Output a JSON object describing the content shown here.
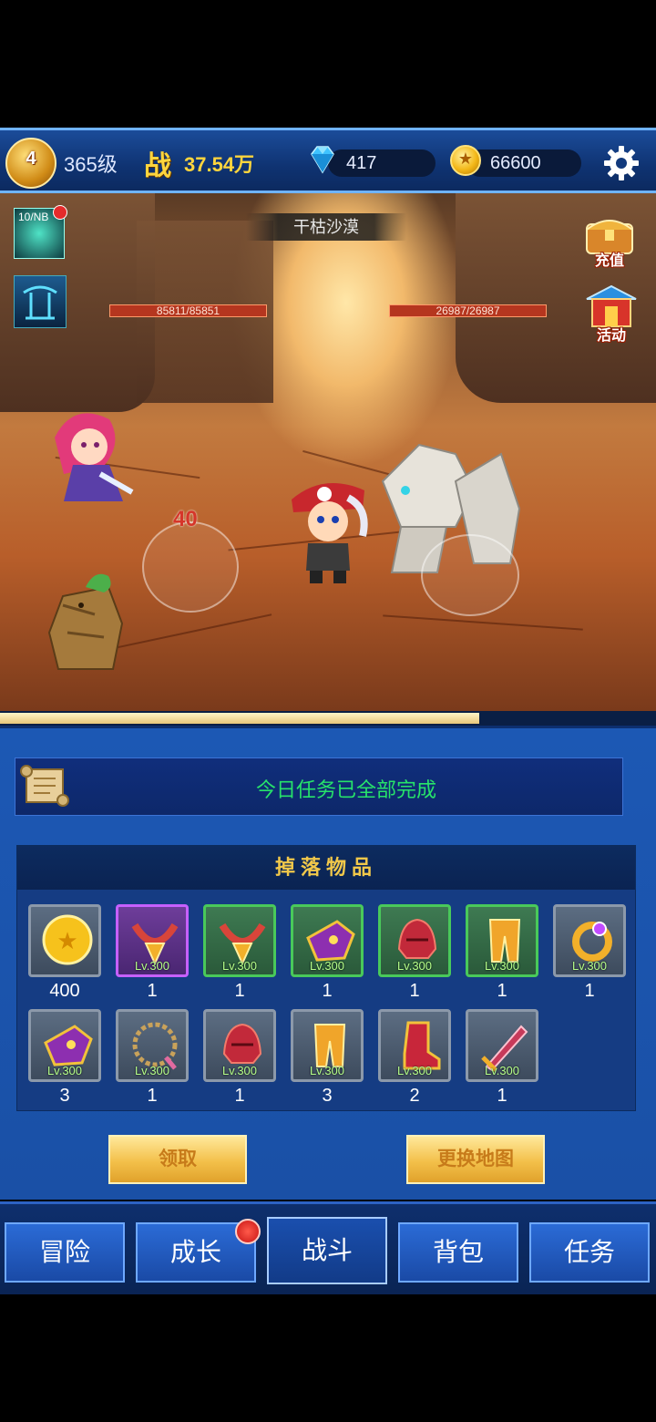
{
  "top_bar": {
    "player_level_badge": "4",
    "player_level": "365级",
    "power_label": "战",
    "power_value": "37.54万",
    "gems": "417",
    "gold": "66600"
  },
  "battle": {
    "location": "干枯沙漠",
    "ally_hp": "85811/85851",
    "enemy_hp": "26987/26987",
    "skill_count": "10/NB",
    "damage_popup": "40",
    "side_buttons": {
      "recharge": "充值",
      "event": "活动"
    }
  },
  "stage_progress": 0.73,
  "task": {
    "text": "今日任务已全部完成"
  },
  "drops": {
    "title": "掉落物品",
    "items": [
      {
        "kind": "gold-coin",
        "rarity": "gray",
        "level": "",
        "qty": "400"
      },
      {
        "kind": "necklace",
        "rarity": "purple",
        "level": "Lv.300",
        "qty": "1"
      },
      {
        "kind": "necklace",
        "rarity": "green",
        "level": "Lv.300",
        "qty": "1"
      },
      {
        "kind": "gauntlet",
        "rarity": "green",
        "level": "Lv.300",
        "qty": "1"
      },
      {
        "kind": "helmet",
        "rarity": "green",
        "level": "Lv.300",
        "qty": "1"
      },
      {
        "kind": "leg-armor",
        "rarity": "green",
        "level": "Lv.300",
        "qty": "1"
      },
      {
        "kind": "ring",
        "rarity": "gray",
        "level": "Lv.300",
        "qty": "1"
      },
      {
        "kind": "gauntlet",
        "rarity": "gray",
        "level": "Lv.300",
        "qty": "3"
      },
      {
        "kind": "chain",
        "rarity": "gray",
        "level": "Lv.300",
        "qty": "1"
      },
      {
        "kind": "helmet",
        "rarity": "gray",
        "level": "Lv.300",
        "qty": "1"
      },
      {
        "kind": "leg-armor",
        "rarity": "gray",
        "level": "Lv.300",
        "qty": "3"
      },
      {
        "kind": "boots",
        "rarity": "gray",
        "level": "Lv.300",
        "qty": "2"
      },
      {
        "kind": "sword",
        "rarity": "gray",
        "level": "Lv.300",
        "qty": "1"
      }
    ]
  },
  "buttons": {
    "claim": "领取",
    "change_map": "更换地图"
  },
  "tabs": [
    {
      "label": "冒险"
    },
    {
      "label": "成长",
      "has_dot": true
    },
    {
      "label": "战斗",
      "active": true
    },
    {
      "label": "背包"
    },
    {
      "label": "任务"
    }
  ]
}
